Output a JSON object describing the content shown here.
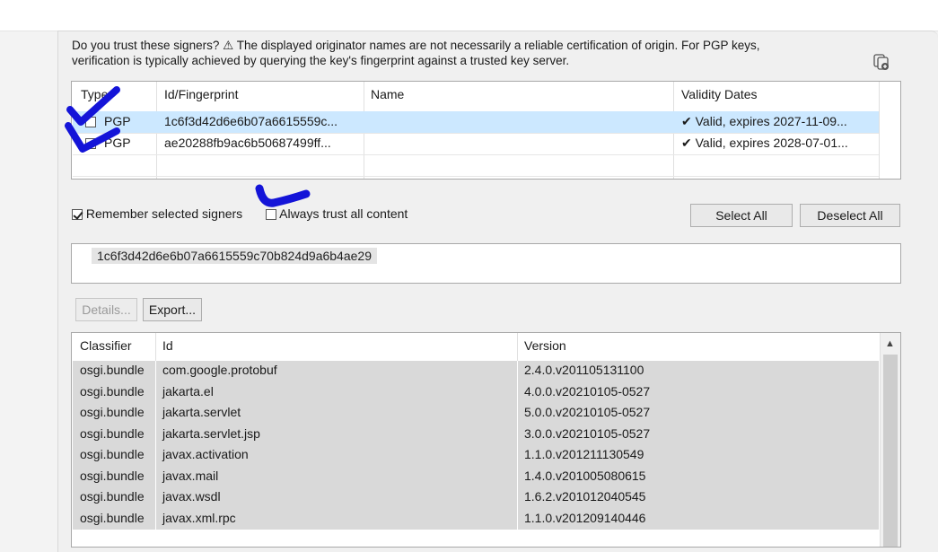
{
  "intro": {
    "line1": "Do you trust these signers? ⚠ The displayed originator names are not necessarily a reliable certification of origin.  For PGP keys,",
    "line2": "verification is typically achieved by querying the key's fingerprint against a trusted key server."
  },
  "signers": {
    "headers": {
      "type": "Type",
      "id": "Id/Fingerprint",
      "name": "Name",
      "validity": "Validity Dates"
    },
    "rows": [
      {
        "type": "PGP",
        "id": "1c6f3d42d6e6b07a6615559c...",
        "name": "",
        "validity": "✔ Valid, expires 2027-11-09...",
        "selected": true
      },
      {
        "type": "PGP",
        "id": "ae20288fb9ac6b50687499ff...",
        "name": "",
        "validity": "✔ Valid, expires 2028-07-01...",
        "selected": false
      }
    ]
  },
  "options": {
    "remember_label": "Remember selected signers",
    "remember_checked": true,
    "always_trust_label": "Always trust all content",
    "always_trust_checked": false
  },
  "buttons": {
    "select_all": "Select All",
    "deselect_all": "Deselect All",
    "details": "Details...",
    "export": "Export..."
  },
  "fingerprint": "1c6f3d42d6e6b07a6615559c70b824d9a6b4ae29",
  "artifacts": {
    "headers": {
      "classifier": "Classifier",
      "id": "Id",
      "version": "Version"
    },
    "rows": [
      {
        "classifier": "osgi.bundle",
        "id": "com.google.protobuf",
        "version": "2.4.0.v201105131100"
      },
      {
        "classifier": "osgi.bundle",
        "id": "jakarta.el",
        "version": "4.0.0.v20210105-0527"
      },
      {
        "classifier": "osgi.bundle",
        "id": "jakarta.servlet",
        "version": "5.0.0.v20210105-0527"
      },
      {
        "classifier": "osgi.bundle",
        "id": "jakarta.servlet.jsp",
        "version": "3.0.0.v20210105-0527"
      },
      {
        "classifier": "osgi.bundle",
        "id": "javax.activation",
        "version": "1.1.0.v201211130549"
      },
      {
        "classifier": "osgi.bundle",
        "id": "javax.mail",
        "version": "1.4.0.v201005080615"
      },
      {
        "classifier": "osgi.bundle",
        "id": "javax.wsdl",
        "version": "1.6.2.v201012040545"
      },
      {
        "classifier": "osgi.bundle",
        "id": "javax.xml.rpc",
        "version": "1.1.0.v201209140446"
      }
    ]
  },
  "colors": {
    "selection": "#cce8ff",
    "annotation": "#1414d8",
    "row_bg": "#d9d9d9"
  },
  "icons": {
    "copy": "copy-icon",
    "scroll_up": "chevron-up-icon"
  }
}
